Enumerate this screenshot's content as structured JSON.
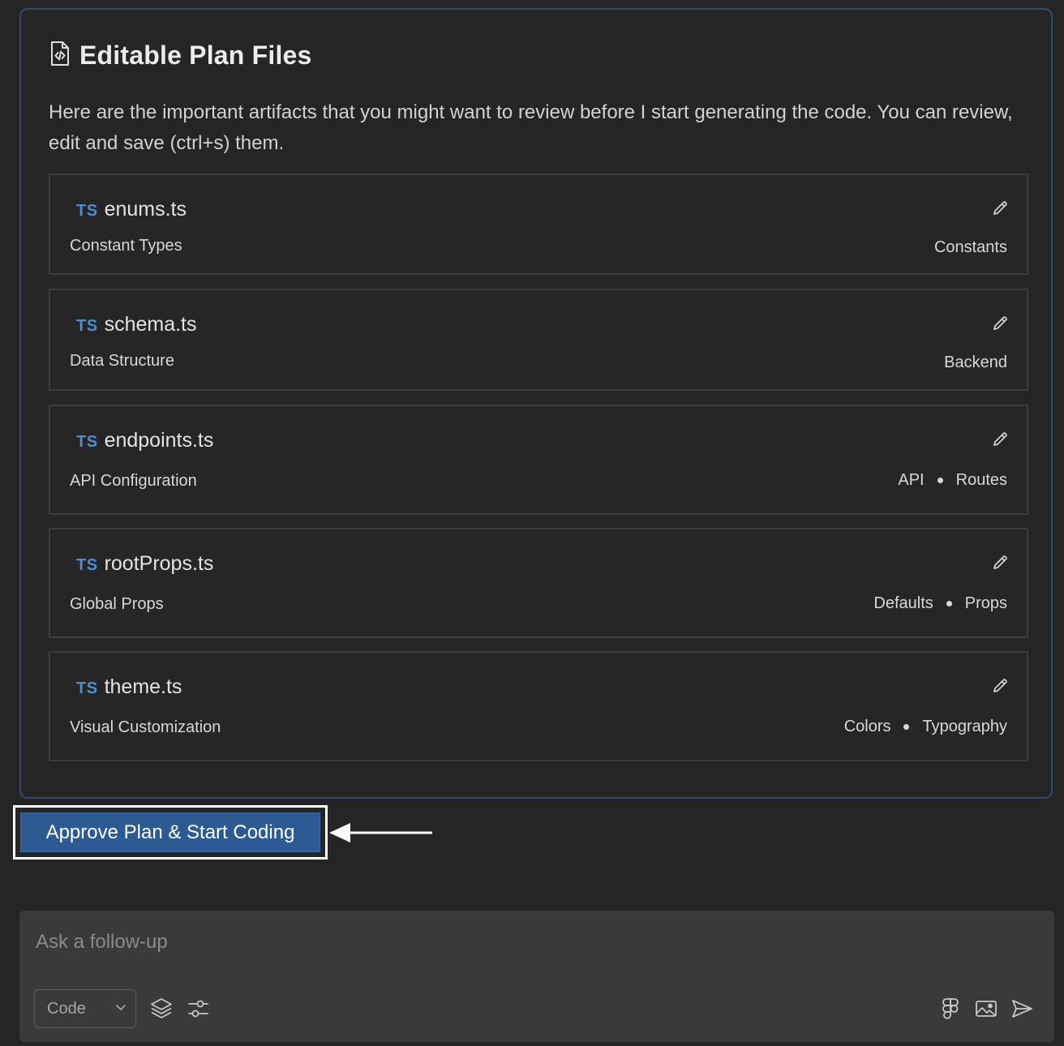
{
  "plan": {
    "title": "Editable Plan Files",
    "description": "Here are the important artifacts that you might want to review before I start generating the code. You can review, edit and save (ctrl+s) them.",
    "files": [
      {
        "lang": "TS",
        "name": "enums.ts",
        "description": "Constant Types",
        "tags": [
          "Constants"
        ]
      },
      {
        "lang": "TS",
        "name": "schema.ts",
        "description": "Data Structure",
        "tags": [
          "Backend"
        ]
      },
      {
        "lang": "TS",
        "name": "endpoints.ts",
        "description": "API Configuration",
        "tags": [
          "API",
          "Routes"
        ]
      },
      {
        "lang": "TS",
        "name": "rootProps.ts",
        "description": "Global Props",
        "tags": [
          "Defaults",
          "Props"
        ]
      },
      {
        "lang": "TS",
        "name": "theme.ts",
        "description": "Visual Customization",
        "tags": [
          "Colors",
          "Typography"
        ]
      }
    ]
  },
  "actions": {
    "approve_label": "Approve Plan & Start Coding"
  },
  "composer": {
    "placeholder": "Ask a follow-up",
    "value": "",
    "mode": "Code"
  },
  "icons": {
    "plan_title": "file-code-icon",
    "edit": "pencil-icon",
    "mode_dropdown": "chevron-down-icon",
    "context": "layers-icon",
    "settings": "sliders-icon",
    "figma": "figma-icon",
    "image": "image-icon",
    "send": "send-icon",
    "annotation": "arrow-left-icon"
  },
  "colors": {
    "background": "#252525",
    "card_border": "#2f4a6d",
    "ts_accent": "#4a8fd6",
    "approve_button": "#2c5a93",
    "composer_bg": "#3a3a3a"
  }
}
